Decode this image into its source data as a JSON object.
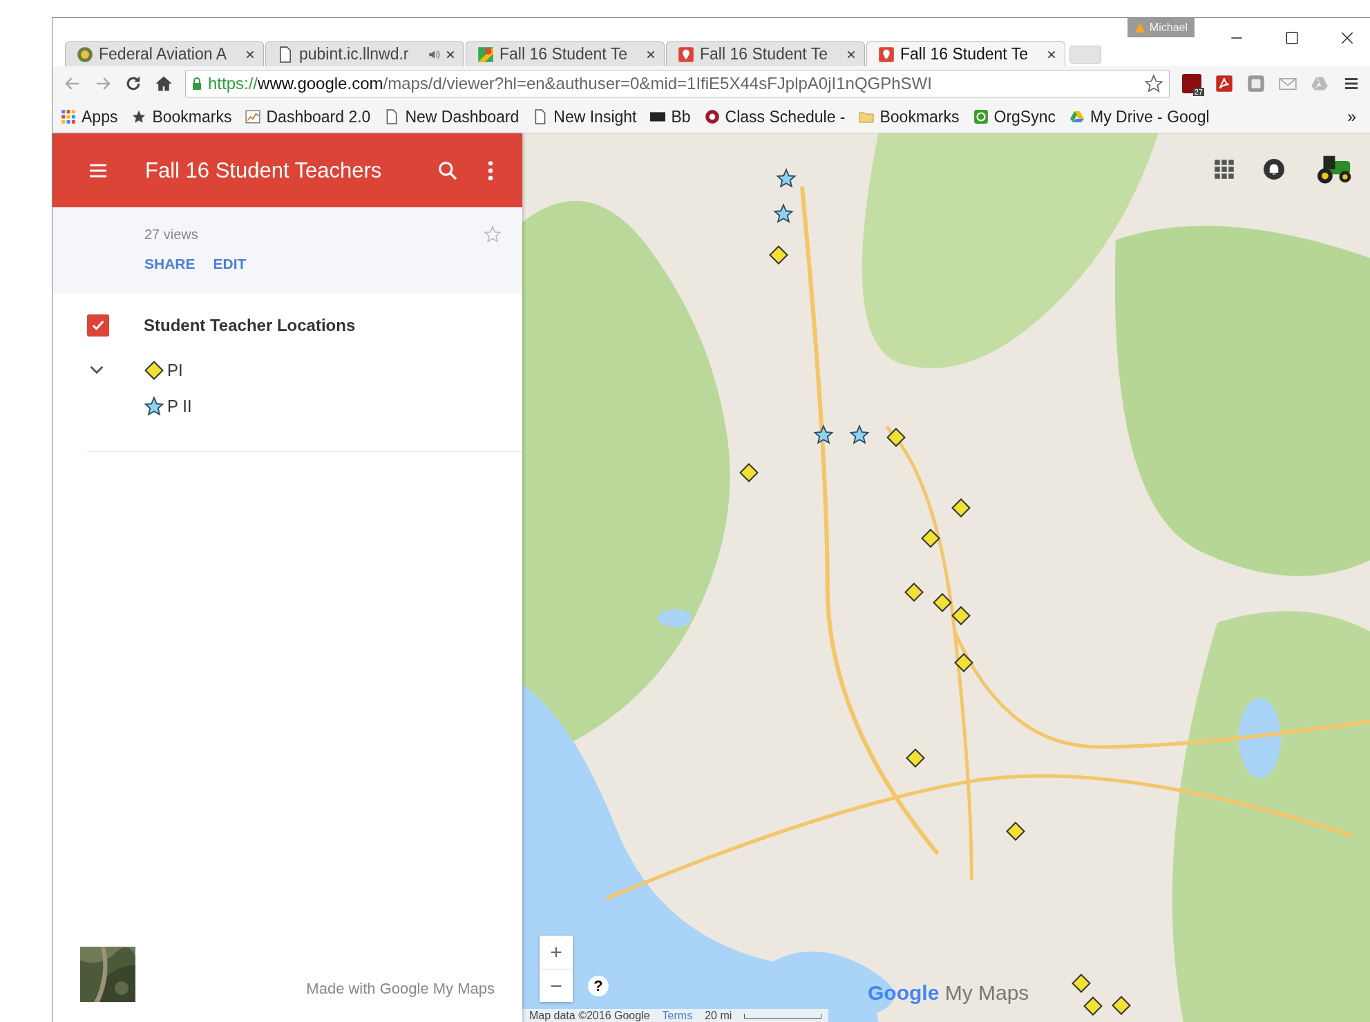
{
  "window": {
    "user_badge": "Michael"
  },
  "tabs": [
    {
      "title": "Federal Aviation A",
      "kind": "globe",
      "audio": false,
      "selected": false
    },
    {
      "title": "pubint.ic.llnwd.r",
      "kind": "page",
      "audio": true,
      "selected": false
    },
    {
      "title": "Fall 16 Student Te",
      "kind": "maps",
      "audio": false,
      "selected": false
    },
    {
      "title": "Fall 16 Student Te",
      "kind": "pin",
      "audio": false,
      "selected": false
    },
    {
      "title": "Fall 16 Student Te",
      "kind": "pin",
      "audio": false,
      "selected": true
    }
  ],
  "toolbar": {
    "url_scheme": "https://",
    "url_host": "www.google.com",
    "url_path": "/maps/d/viewer?hl=en&authuser=0&mid=1IfiE5X44sFJplpA0jI1nQGPhSWI",
    "extension_badge": "27"
  },
  "bookmarks": [
    {
      "label": "Apps",
      "kind": "apps"
    },
    {
      "label": "Bookmarks",
      "kind": "star"
    },
    {
      "label": "Dashboard 2.0",
      "kind": "chart"
    },
    {
      "label": "New Dashboard",
      "kind": "page"
    },
    {
      "label": "New Insight",
      "kind": "page"
    },
    {
      "label": "Bb",
      "kind": "bb"
    },
    {
      "label": "Class Schedule -",
      "kind": "class"
    },
    {
      "label": "Bookmarks",
      "kind": "folder"
    },
    {
      "label": "OrgSync",
      "kind": "orgsync"
    },
    {
      "label": "My Drive - Googl",
      "kind": "drive"
    }
  ],
  "bookmarks_overflow": "»",
  "sidebar": {
    "title": "Fall 16 Student Teachers",
    "views": "27 views",
    "actions": [
      "SHARE",
      "EDIT"
    ],
    "layer": {
      "name": "Student Teacher Locations",
      "checked": true,
      "expanded": true,
      "legend": [
        {
          "label": "PI",
          "kind": "diamond"
        },
        {
          "label": "P II",
          "kind": "star"
        }
      ]
    },
    "footer": "Made with Google My Maps"
  },
  "map": {
    "zoom_in": "+",
    "zoom_out": "−",
    "help": "?",
    "logo_google": "Google",
    "logo_product": "My Maps",
    "attribution": "Map data ©2016 Google",
    "terms": "Terms",
    "scale": "20 mi"
  }
}
